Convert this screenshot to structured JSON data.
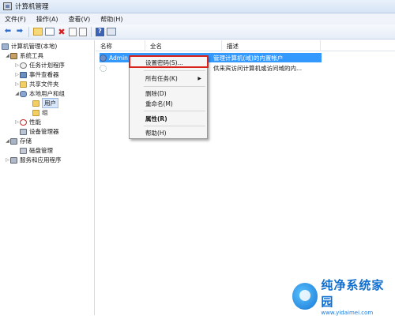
{
  "window": {
    "title": "计算机管理"
  },
  "menubar": [
    "文件(F)",
    "操作(A)",
    "查看(V)",
    "帮助(H)"
  ],
  "toolbar": {
    "icons": [
      "back-arrow-icon",
      "forward-arrow-icon",
      "up-folder-icon",
      "show-hide-tree-icon",
      "delete-icon",
      "properties-icon",
      "export-list-icon",
      "help-icon",
      "mmc-console-icon"
    ],
    "delete_glyph": "✖",
    "help_glyph": "?"
  },
  "tree": {
    "root": "计算机管理(本地)",
    "system_tools": "系统工具",
    "task_scheduler": "任务计划程序",
    "event_viewer": "事件查看器",
    "shared_folders": "共享文件夹",
    "local_users_groups": "本地用户和组",
    "users": "用户",
    "groups": "组",
    "performance": "性能",
    "device_manager": "设备管理器",
    "storage": "存储",
    "disk_management": "磁盘管理",
    "services_apps": "服务和应用程序"
  },
  "list": {
    "columns": {
      "name": "名称",
      "fullname": "全名",
      "description": "描述"
    },
    "rows": [
      {
        "name": "Admin",
        "fullname": "",
        "description": "管理计算机(域)的内置帐户"
      },
      {
        "name": "",
        "fullname": "",
        "description": "供来宾访问计算机或访问域的内..."
      }
    ]
  },
  "context_menu": {
    "set_password": "设置密码(S)...",
    "all_tasks": "所有任务(K)",
    "submenu_arrow": "▶",
    "delete": "删除(D)",
    "rename": "重命名(M)",
    "properties": "属性(R)",
    "help": "帮助(H)"
  },
  "watermark": {
    "line1": "纯净系统家园",
    "line2": "www.yidaimei.com"
  },
  "colors": {
    "selection": "#3399ff",
    "highlight_box": "#d8231c",
    "watermark": "#0f6fd0"
  }
}
